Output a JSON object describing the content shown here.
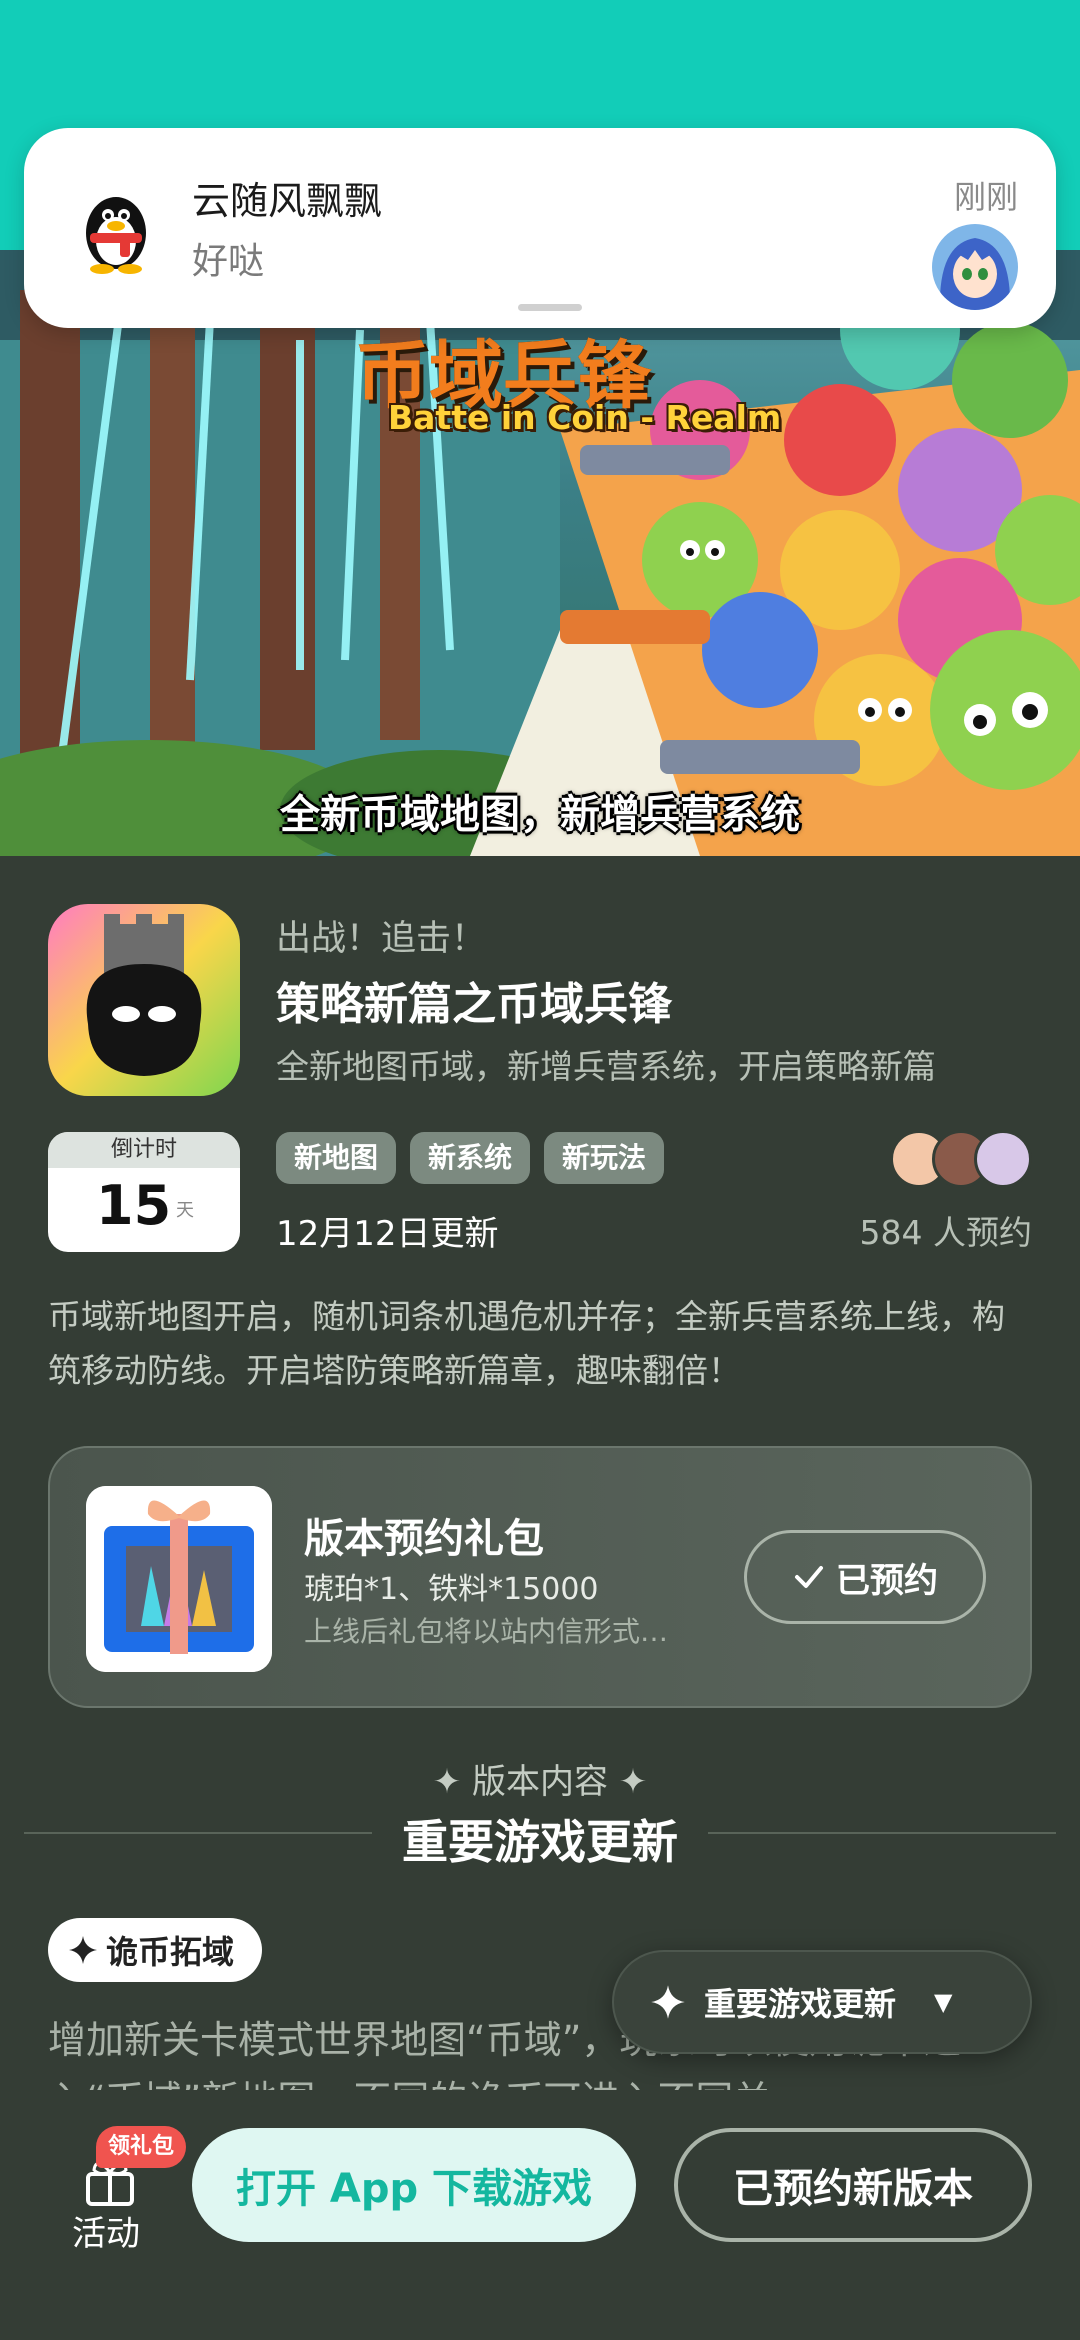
{
  "notification": {
    "sender": "云随风飘飘",
    "message": "好哒",
    "time": "刚刚",
    "icon": "qq-penguin-icon"
  },
  "banner": {
    "title": "币域兵锋",
    "subtitle": "Batte in Coin - Realm",
    "caption": "全新币域地图，新增兵营系统"
  },
  "app": {
    "tagline": "出战！追击！",
    "title": "策略新篇之币域兵锋",
    "description": "全新地图币域，新增兵营系统，开启策略新篇"
  },
  "countdown": {
    "label": "倒计时",
    "value": "15",
    "unit": "天"
  },
  "tags": [
    "新地图",
    "新系统",
    "新玩法"
  ],
  "update_date": "12月12日更新",
  "reserve_count": "584 人预约",
  "intro": "币域新地图开启，随机词条机遇危机并存；全新兵营系统上线，构筑移动防线。开启塔防策略新篇章，趣味翻倍！",
  "gift": {
    "title": "版本预约礼包",
    "items": "琥珀*1、铁料*15000",
    "note": "上线后礼包将以站内信形式…",
    "button": "已预约"
  },
  "section": {
    "subtitle": "✦ 版本内容 ✦",
    "title": "重要游戏更新"
  },
  "content": {
    "chip": "诡币拓域",
    "text": "增加新关卡模式世界地图“币域”，玩家可以使用诡币进入“币域”新地图，不同的诡币可进入不同关"
  },
  "float_nav": {
    "label": "重要游戏更新"
  },
  "bottom": {
    "activity_label": "活动",
    "activity_badge": "领礼包",
    "open_button": "打开 App 下载游戏",
    "reserved_button": "已预约新版本"
  },
  "colors": {
    "teal": "#12cdb8",
    "background": "#343d35",
    "badge_red": "#f0544f"
  }
}
